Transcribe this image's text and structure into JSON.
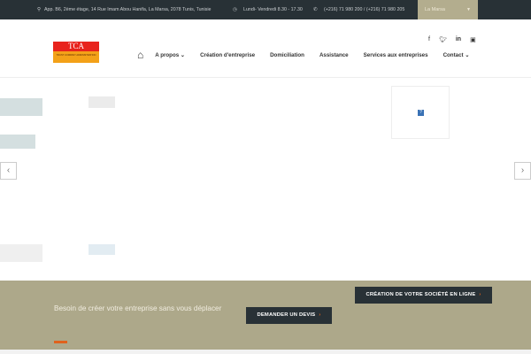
{
  "topbar": {
    "address": "App. B6, 2ème étage, 14 Rue Imam Abou Hanifa, La Marsa, 2078 Tunis, Tunisie",
    "hours": "Lundi- Vendredi 8.30 - 17.30",
    "phone": "(+216) 71 980 200 / (+216) 71 980 205",
    "city": "La Marsa"
  },
  "logo": {
    "name": "TCA",
    "subtitle": "TRUST COMPANY ADMINISTRATION"
  },
  "nav": {
    "items": [
      "A propos",
      "Création d'entreprise",
      "Domiciliation",
      "Assistance",
      "Services aux entreprises",
      "Contact"
    ]
  },
  "social": [
    "f",
    "t",
    "in",
    "yt"
  ],
  "image_placeholder": "?",
  "band": {
    "text": "Besoin de créer votre entreprise sans vous déplacer",
    "btn_devis": "DEMANDER UN DEVIS",
    "btn_creation": "CRÉATION DE VOTRE SOCIÉTÉ EN LIGNE"
  },
  "colors": {
    "topbar": "#283136",
    "accent": "#e0621c",
    "band": "#ada88a"
  }
}
